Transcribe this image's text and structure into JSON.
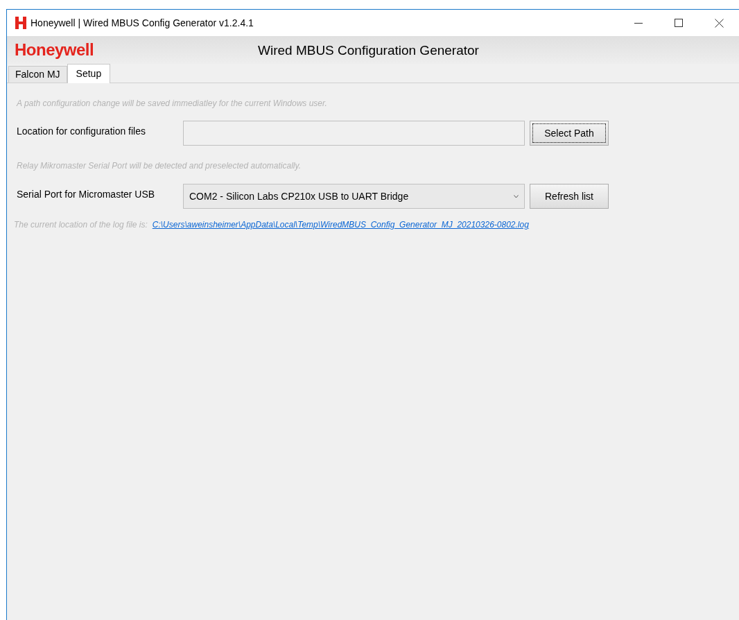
{
  "window": {
    "title": "Honeywell | Wired MBUS Config Generator v1.2.4.1"
  },
  "header": {
    "logo": "Honeywell",
    "title": "Wired MBUS Configuration Generator"
  },
  "tabs": [
    {
      "label": "Falcon MJ",
      "selected": false
    },
    {
      "label": "Setup",
      "selected": true
    }
  ],
  "setup": {
    "path_note": "A path configuration change will be saved immediatley for the current Windows user.",
    "location": {
      "label": "Location for configuration files",
      "button": {
        "label": "Select Path",
        "focused": true
      }
    },
    "port_note": "Relay Mikromaster Serial Port will be detected and preselected automatically.",
    "serial_port": {
      "label": "Serial Port for Micromaster USB",
      "value": "COM2 - Silicon Labs CP210x USB to UART Bridge",
      "button": {
        "label": "Refresh list",
        "focused": false
      }
    },
    "log_label": "The current location of the log file is:",
    "log_path": "C:\\Users\\aweinsheimer\\AppData\\Local\\Temp\\WiredMBUS_Config_Generator_MJ_20210326-0802.log"
  }
}
